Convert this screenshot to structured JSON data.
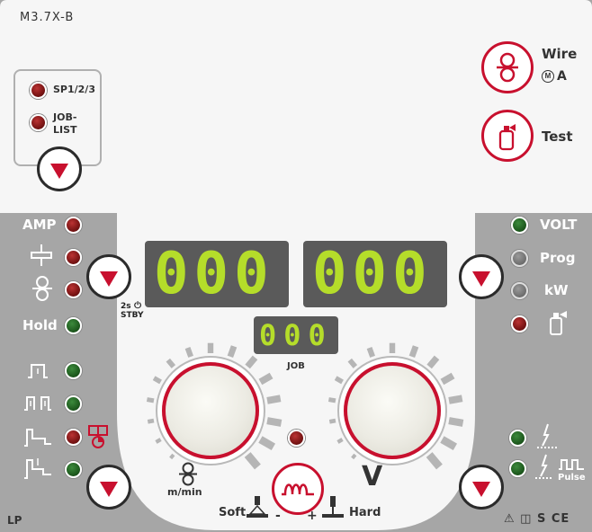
{
  "model": "M3.7X-B",
  "footer": {
    "left": "LP",
    "right_symbols": "⚠ ◫ S CE"
  },
  "colors": {
    "accent": "#c8102e",
    "display_text": "#b5dd2a",
    "display_bg": "#5a5a5a",
    "panel_white": "#f6f6f6",
    "panel_gray": "#a6a6a6"
  },
  "job_selector": {
    "items": [
      {
        "label": "SP1/2/3",
        "led": "red"
      },
      {
        "label_line1": "JOB-",
        "label_line2": "LIST",
        "led": "red"
      }
    ]
  },
  "top_right": {
    "wire": {
      "label": "Wire",
      "sub": "A",
      "icon": "wire-feed-rollers-icon"
    },
    "test": {
      "label": "Test",
      "icon": "gas-test-icon"
    }
  },
  "left_params": [
    {
      "label": "AMP",
      "led": "red"
    },
    {
      "icon": "plate-thickness-icon",
      "led": "red"
    },
    {
      "icon": "wire-speed-icon",
      "led": "red"
    },
    {
      "label": "Hold",
      "led": "green"
    }
  ],
  "left_modes": [
    {
      "icon": "2-cycle-icon",
      "led": "green"
    },
    {
      "icon": "4-cycle-icon",
      "led": "green"
    },
    {
      "icon": "special-cycle-icon",
      "led": "red"
    },
    {
      "icon": "spot-cycle-icon",
      "led": "green"
    }
  ],
  "standby": {
    "line1": "2s",
    "line2": "STBY"
  },
  "right_params": [
    {
      "label": "VOLT",
      "led": "green"
    },
    {
      "label": "Prog",
      "led": "gray"
    },
    {
      "label": "kW",
      "led": "gray"
    },
    {
      "icon": "gas-cylinder-icon",
      "led": "red"
    }
  ],
  "right_process": [
    {
      "icon": "standard-mig-icon",
      "led": "green"
    },
    {
      "icon": "pulse-mig-icon",
      "label": "Pulse",
      "led": "green"
    }
  ],
  "displays": {
    "left": "000",
    "right": "000",
    "job": "000",
    "job_label": "JOB"
  },
  "knobs": {
    "left_label": "m/min",
    "right_label": "V"
  },
  "dynamics": {
    "soft": "Soft",
    "minus": "-",
    "plus": "+",
    "hard": "Hard"
  }
}
